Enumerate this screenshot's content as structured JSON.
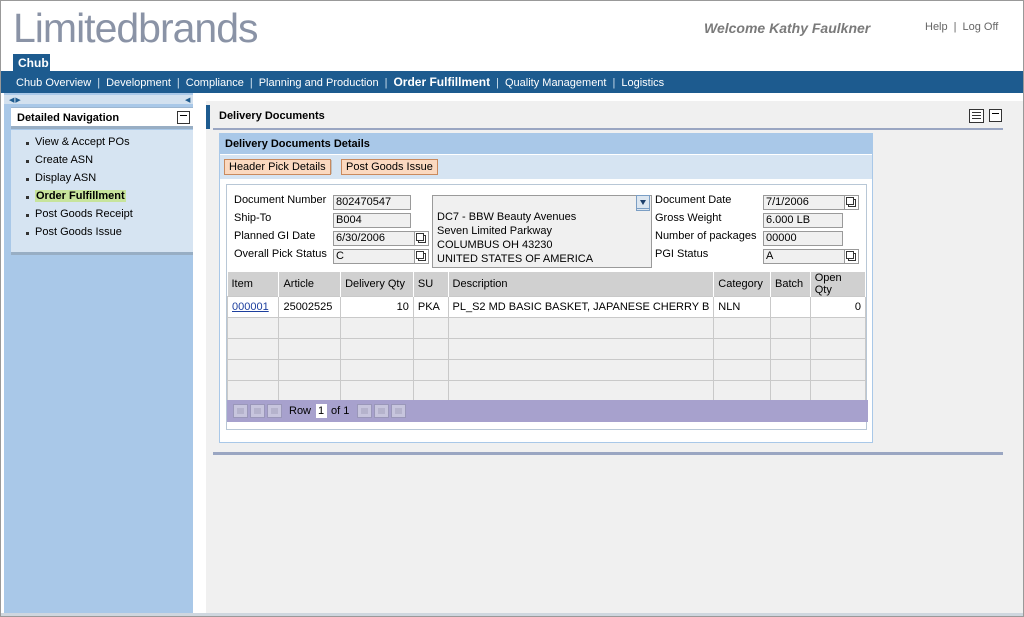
{
  "header": {
    "logo_text": "Limitedbrands",
    "welcome": "Welcome Kathy Faulkner",
    "help_link": "Help",
    "separator": "|",
    "logoff_link": "Log Off"
  },
  "top_tab": {
    "label": "Chub"
  },
  "nav": {
    "items": [
      {
        "label": "Chub Overview"
      },
      {
        "label": "Development"
      },
      {
        "label": "Compliance"
      },
      {
        "label": "Planning and Production"
      },
      {
        "label": "Order Fulfillment",
        "active": true
      },
      {
        "label": "Quality Management"
      },
      {
        "label": "Logistics"
      }
    ]
  },
  "detailed_navigation": {
    "title": "Detailed Navigation",
    "items": [
      {
        "label": "View & Accept POs"
      },
      {
        "label": "Create ASN"
      },
      {
        "label": "Display ASN"
      },
      {
        "label": "Order Fulfillment",
        "active": true
      },
      {
        "label": "Post Goods Receipt"
      },
      {
        "label": "Post Goods Issue"
      }
    ]
  },
  "page": {
    "title": "Delivery Documents",
    "panel_title": "Delivery Documents Details",
    "toolbar": {
      "header_pick_details": "Header Pick Details",
      "post_goods_issue": "Post Goods Issue"
    }
  },
  "form": {
    "document_number": {
      "label": "Document Number",
      "value": "802470547"
    },
    "ship_to": {
      "label": "Ship-To",
      "value": "B004"
    },
    "planned_gi_date": {
      "label": "Planned GI Date",
      "value": "6/30/2006"
    },
    "overall_pick_status": {
      "label": "Overall Pick Status",
      "value": "C"
    },
    "address_lines": [
      "DC7 - BBW Beauty Avenues",
      "Seven Limited Parkway",
      "COLUMBUS OH  43230",
      "UNITED STATES OF AMERICA"
    ],
    "document_date": {
      "label": "Document Date",
      "value": "7/1/2006"
    },
    "gross_weight": {
      "label": "Gross Weight",
      "value": "6.000 LB"
    },
    "number_of_packages": {
      "label": "Number of packages",
      "value": "00000"
    },
    "pgi_status": {
      "label": "PGI Status",
      "value": "A"
    }
  },
  "table": {
    "columns": [
      "Item",
      "Article",
      "Delivery Qty",
      "SU",
      "Description",
      "Category",
      "Batch",
      "Open Qty"
    ],
    "rows": [
      [
        "000001",
        "25002525",
        "10",
        "PKA",
        "PL_S2 MD BASIC BASKET, JAPANESE CHERRY B",
        "NLN",
        "",
        "0"
      ]
    ]
  },
  "pager": {
    "row_label": "Row",
    "current_row": "1",
    "of_label": "of 1"
  }
}
